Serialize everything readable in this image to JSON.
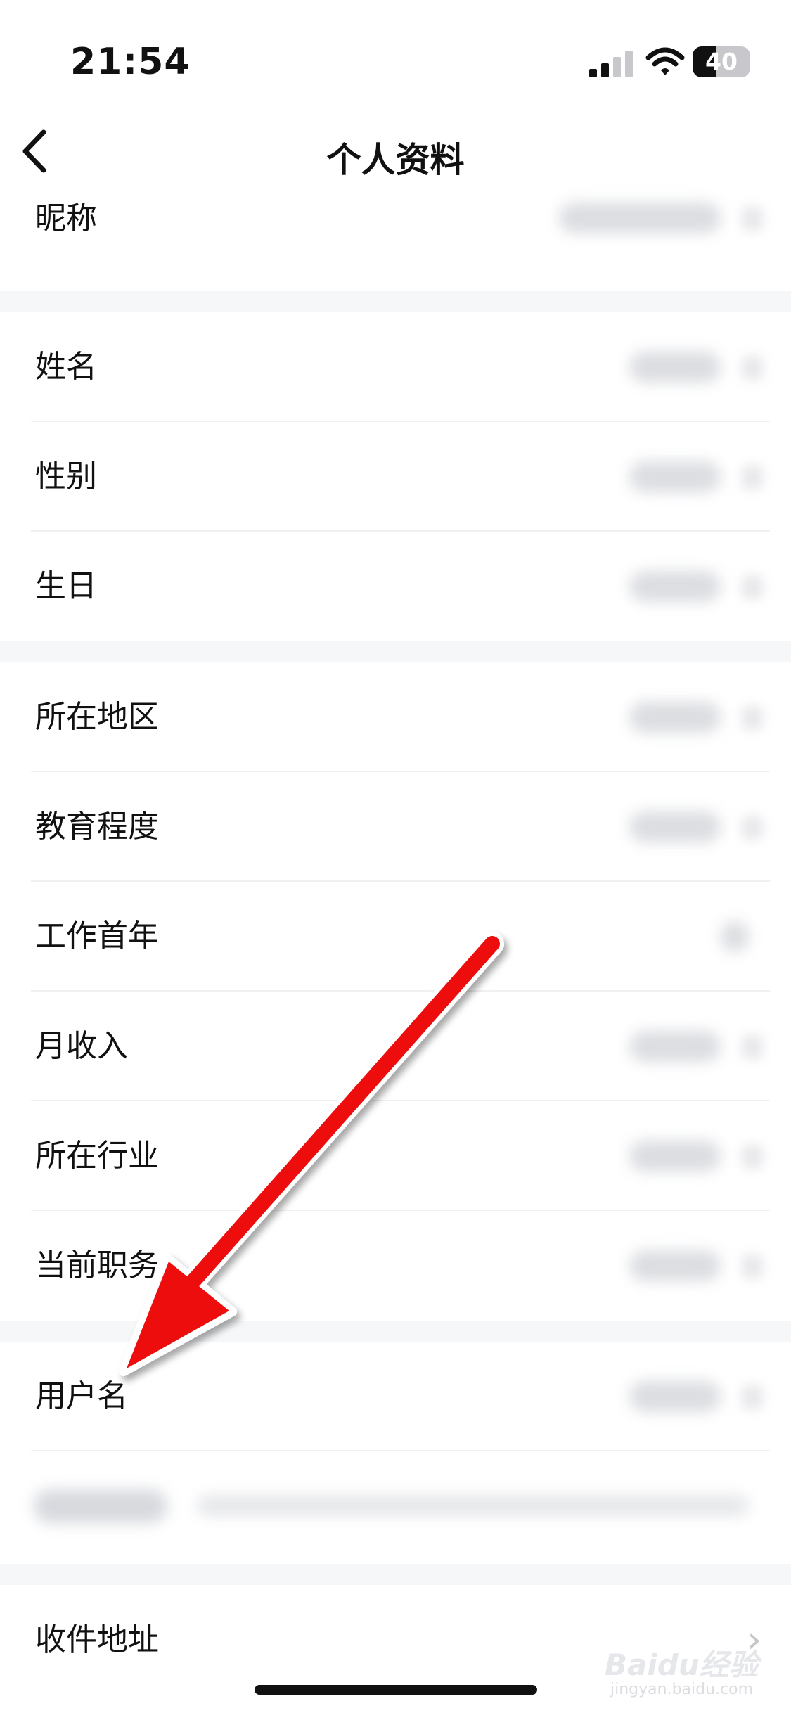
{
  "status_bar": {
    "time": "21:54",
    "battery_level": 40,
    "battery_label": "40",
    "signal_bars_active": 2,
    "signal_bars_total": 4
  },
  "nav": {
    "back_icon": "chevron-left-icon",
    "title": "个人资料"
  },
  "groups": [
    {
      "rows": [
        {
          "label": "昵称"
        }
      ]
    },
    {
      "rows": [
        {
          "label": "姓名"
        },
        {
          "label": "性别"
        },
        {
          "label": "生日"
        }
      ]
    },
    {
      "rows": [
        {
          "label": "所在地区"
        },
        {
          "label": "教育程度"
        },
        {
          "label": "工作首年"
        },
        {
          "label": "月收入"
        },
        {
          "label": "所在行业"
        },
        {
          "label": "当前职务"
        }
      ]
    },
    {
      "rows": [
        {
          "label": "用户名"
        }
      ]
    },
    {
      "rows": [
        {
          "label": "收件地址"
        }
      ]
    }
  ],
  "annotation": {
    "arrow_color": "#ee1111",
    "points_to": "用户名"
  },
  "watermark": {
    "text": "Baidu经验",
    "subtext": "jingyan.baidu.com"
  },
  "colors": {
    "background": "#ffffff",
    "separator": "#f6f7f9",
    "arrow": "#ee1111"
  }
}
